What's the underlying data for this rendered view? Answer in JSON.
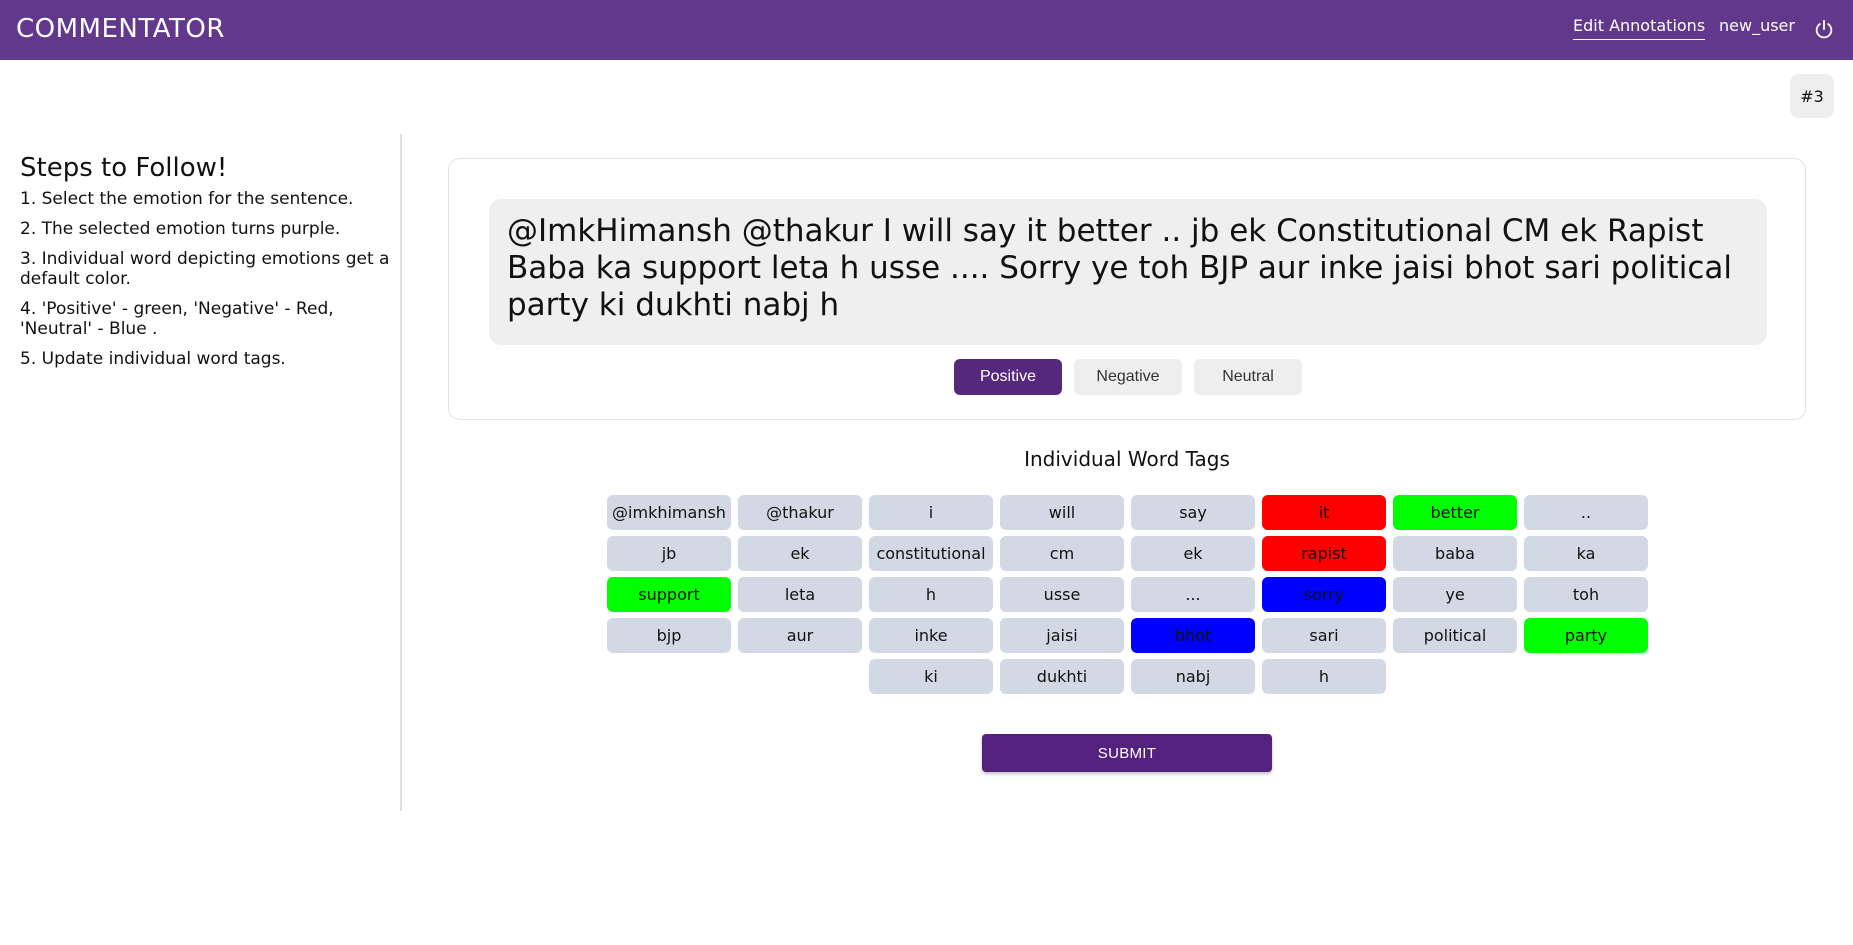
{
  "header": {
    "brand": "COMMENTATOR",
    "edit_annotations": "Edit Annotations",
    "username": "new_user",
    "power_icon": "power-icon"
  },
  "badge": "#3",
  "sidebar": {
    "title": "Steps to Follow!",
    "steps": [
      "1. Select the emotion for the sentence.",
      "2. The selected emotion turns purple.",
      "3. Individual word depicting emotions get a default color.",
      "4. 'Positive' - green, 'Negative' - Red, 'Neutral' - Blue .",
      "5. Update individual word tags."
    ]
  },
  "sentence": "@ImkHimansh @thakur I will say it better .. jb ek Constitutional CM ek Rapist Baba ka support leta h usse .... Sorry ye toh BJP aur inke jaisi bhot sari political party ki dukhti nabj h",
  "emotions": [
    {
      "label": "Positive",
      "selected": true
    },
    {
      "label": "Negative",
      "selected": false
    },
    {
      "label": "Neutral",
      "selected": false
    }
  ],
  "tags_title": "Individual Word Tags",
  "colors": {
    "selected": "#55287e",
    "positive": "#00ff00",
    "negative": "#ff0000",
    "neutral": "#0000ff",
    "default": "#d2d9e4"
  },
  "tags": [
    {
      "word": "@imkhimansh",
      "tag": "none"
    },
    {
      "word": "@thakur",
      "tag": "none"
    },
    {
      "word": "i",
      "tag": "none"
    },
    {
      "word": "will",
      "tag": "none"
    },
    {
      "word": "say",
      "tag": "none"
    },
    {
      "word": "it",
      "tag": "neg"
    },
    {
      "word": "better",
      "tag": "pos"
    },
    {
      "word": "..",
      "tag": "none"
    },
    {
      "word": "jb",
      "tag": "none"
    },
    {
      "word": "ek",
      "tag": "none"
    },
    {
      "word": "constitutional",
      "tag": "none"
    },
    {
      "word": "cm",
      "tag": "none"
    },
    {
      "word": "ek",
      "tag": "none"
    },
    {
      "word": "rapist",
      "tag": "neg"
    },
    {
      "word": "baba",
      "tag": "none"
    },
    {
      "word": "ka",
      "tag": "none"
    },
    {
      "word": "support",
      "tag": "pos"
    },
    {
      "word": "leta",
      "tag": "none"
    },
    {
      "word": "h",
      "tag": "none"
    },
    {
      "word": "usse",
      "tag": "none"
    },
    {
      "word": "...",
      "tag": "none"
    },
    {
      "word": "sorry",
      "tag": "neu"
    },
    {
      "word": "ye",
      "tag": "none"
    },
    {
      "word": "toh",
      "tag": "none"
    },
    {
      "word": "bjp",
      "tag": "none"
    },
    {
      "word": "aur",
      "tag": "none"
    },
    {
      "word": "inke",
      "tag": "none"
    },
    {
      "word": "jaisi",
      "tag": "none"
    },
    {
      "word": "bhot",
      "tag": "neu"
    },
    {
      "word": "sari",
      "tag": "none"
    },
    {
      "word": "political",
      "tag": "none"
    },
    {
      "word": "party",
      "tag": "pos"
    },
    {
      "word": "ki",
      "tag": "none"
    },
    {
      "word": "dukhti",
      "tag": "none"
    },
    {
      "word": "nabj",
      "tag": "none"
    },
    {
      "word": "h",
      "tag": "none"
    }
  ],
  "submit_label": "SUBMIT"
}
